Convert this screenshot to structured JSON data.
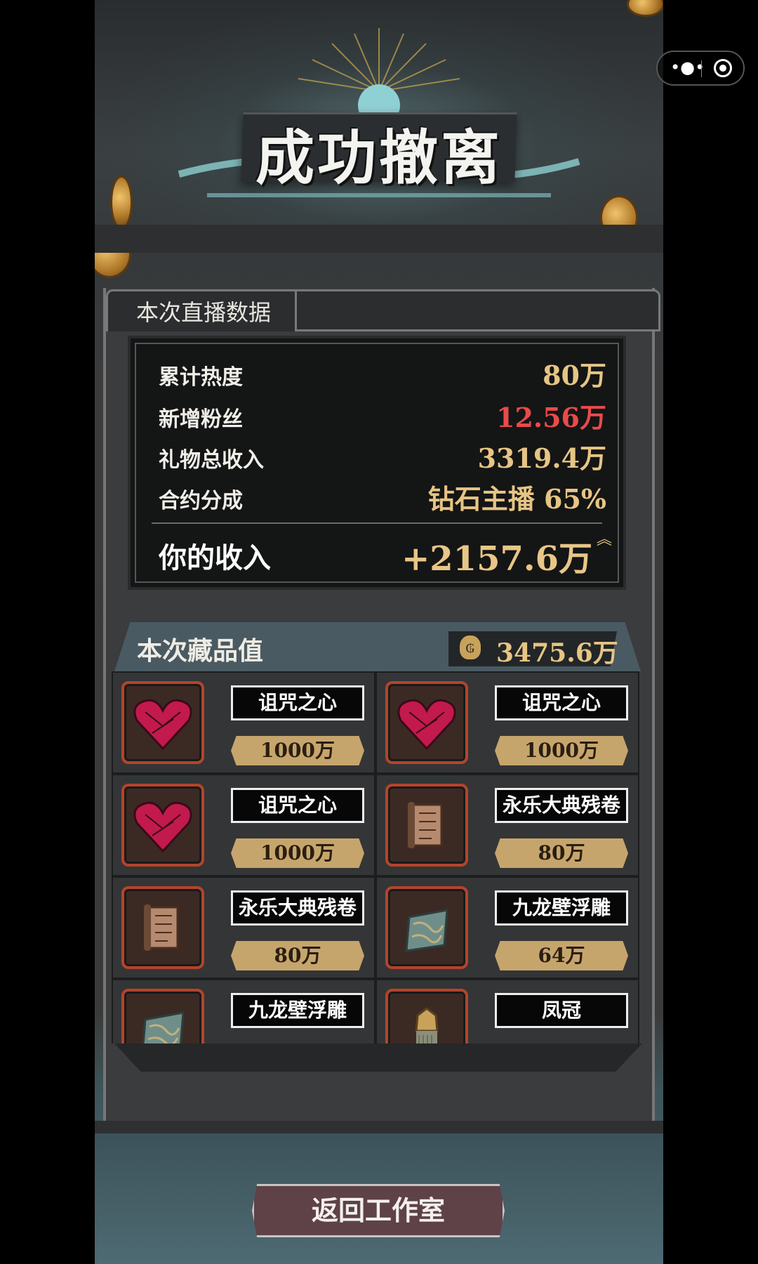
{
  "header": {
    "title": "成功撤离"
  },
  "stream_tab": {
    "label": "本次直播数据"
  },
  "stats": [
    {
      "label": "累计热度",
      "value": "80万",
      "highlight": false
    },
    {
      "label": "新增粉丝",
      "value": "12.56万",
      "highlight": true
    },
    {
      "label": "礼物总收入",
      "value": "3319.4万",
      "highlight": false
    },
    {
      "label": "合约分成",
      "value": "钻石主播 65%",
      "highlight": false
    }
  ],
  "income": {
    "label": "你的收入",
    "value": "+2157.6万"
  },
  "collection": {
    "title": "本次藏品值",
    "total": "3475.6万",
    "items": [
      {
        "name": "诅咒之心",
        "value": "1000万",
        "icon": "cursed-heart-icon"
      },
      {
        "name": "诅咒之心",
        "value": "1000万",
        "icon": "cursed-heart-icon"
      },
      {
        "name": "诅咒之心",
        "value": "1000万",
        "icon": "cursed-heart-icon"
      },
      {
        "name": "永乐大典残卷",
        "value": "80万",
        "icon": "scroll-icon"
      },
      {
        "name": "永乐大典残卷",
        "value": "80万",
        "icon": "scroll-icon"
      },
      {
        "name": "九龙壁浮雕",
        "value": "64万",
        "icon": "relief-tile-icon"
      },
      {
        "name": "九龙壁浮雕",
        "value": "",
        "icon": "relief-tile-icon"
      },
      {
        "name": "凤冠",
        "value": "",
        "icon": "phoenix-crown-icon"
      }
    ]
  },
  "return_button": {
    "label": "返回工作室"
  },
  "colors": {
    "gold": "#e6c584",
    "red": "#ea4a4a",
    "button": "#5e4248",
    "thumb_border": "#b4442b"
  }
}
